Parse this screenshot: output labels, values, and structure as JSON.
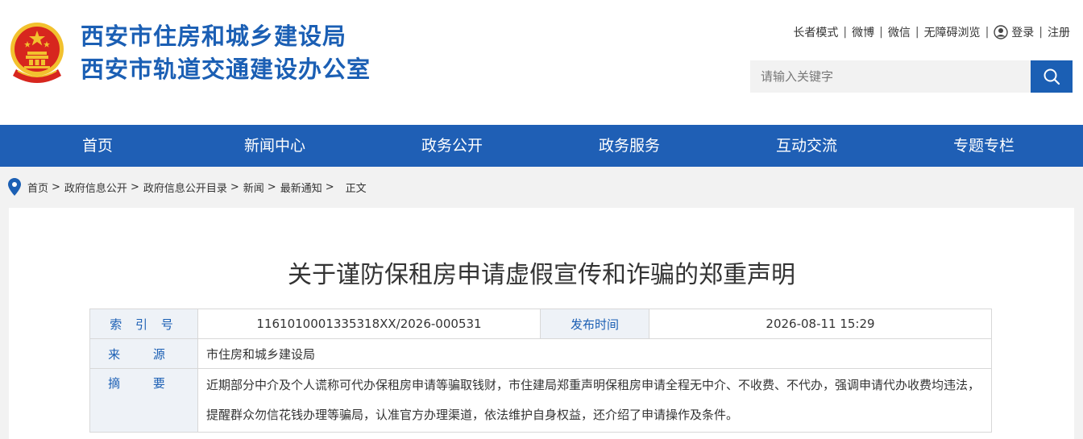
{
  "header": {
    "title_line1": "西安市住房和城乡建设局",
    "title_line2": "西安市轨道交通建设办公室",
    "toplinks": {
      "elder_mode": "长者模式",
      "weibo": "微博",
      "wechat": "微信",
      "accessible": "无障碍浏览",
      "login": "登录",
      "register": "注册"
    },
    "search": {
      "placeholder": "请输入关键字"
    }
  },
  "nav": {
    "items": [
      "首页",
      "新闻中心",
      "政务公开",
      "政务服务",
      "互动交流",
      "专题专栏"
    ]
  },
  "breadcrumb": {
    "items": [
      "首页",
      "政府信息公开",
      "政府信息公开目录",
      "新闻",
      "最新通知"
    ],
    "separator": ">",
    "current": "正文"
  },
  "article": {
    "title": "关于谨防保租房申请虚假宣传和诈骗的郑重声明",
    "meta": {
      "index_label": "索 引 号",
      "index_value": "1161010001335318XX/2026-000531",
      "date_label": "发布时间",
      "date_value": "2026-08-11 15:29",
      "source_label": "来 源",
      "source_value": "市住房和城乡建设局",
      "summary_label": "摘 要",
      "summary_value": "近期部分中介及个人谎称可代办保租房申请等骗取钱财，市住建局郑重声明保租房申请全程无中介、不收费、不代办，强调申请代办收费均违法，提醒群众勿信花钱办理等骗局，认准官方办理渠道，依法维护自身权益，还介绍了申请操作及条件。"
    }
  },
  "colors": {
    "brand_blue": "#1b5fb4",
    "nav_blue": "#1f5fb5",
    "emblem_red": "#d7261e",
    "emblem_gold": "#f2c12e",
    "label_bg": "#eef2f7"
  },
  "icons": {
    "emblem": "national-emblem",
    "search": "search-icon",
    "user": "user-icon",
    "location": "location-pin-icon"
  }
}
